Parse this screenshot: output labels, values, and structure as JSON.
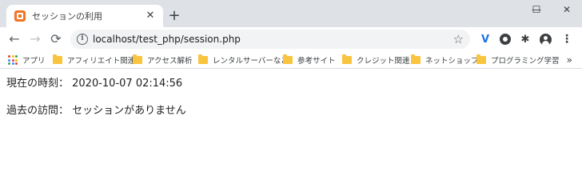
{
  "tab": {
    "title": "セッションの利用",
    "close": "✕"
  },
  "newtab": "+",
  "window": {
    "minimize": "—",
    "maximize": "☐",
    "close": "✕"
  },
  "nav": {
    "back": "←",
    "forward": "→",
    "reload": "⟳"
  },
  "address": {
    "info_icon": "i",
    "url": "localhost/test_php/session.php",
    "star": "☆"
  },
  "extensions": {
    "v": "V",
    "menu": "⋮",
    "puzzle": "✱"
  },
  "bookmarks": {
    "items": [
      {
        "label": "アプリ",
        "icon": "apps-icon"
      },
      {
        "label": "アフィリエイト関連",
        "icon": "folder-icon"
      },
      {
        "label": "アクセス解析",
        "icon": "folder-icon"
      },
      {
        "label": "レンタルサーバーなど",
        "icon": "folder-icon"
      },
      {
        "label": "参考サイト",
        "icon": "folder-icon"
      },
      {
        "label": "クレジット関連",
        "icon": "folder-icon"
      },
      {
        "label": "ネットショップ",
        "icon": "folder-icon"
      },
      {
        "label": "プログラミング学習",
        "icon": "folder-icon"
      }
    ],
    "more": "»"
  },
  "content": {
    "current_time": "現在の時刻： 2020-10-07 02:14:56",
    "past_visit": "過去の訪問： セッションがありません"
  },
  "colors": {
    "folder": "#f9c43f",
    "favicon": "#f37524",
    "tabstrip": "#dee1e6",
    "omnibox": "#f1f3f4"
  }
}
